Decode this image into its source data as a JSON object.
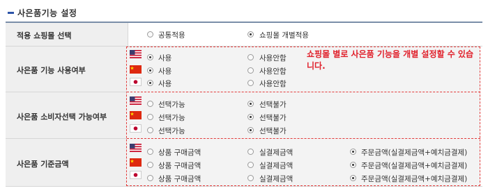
{
  "page_title": "사은품기능 설정",
  "colors": {
    "accent": "#2d54a8",
    "note": "#e0202b",
    "dash_border": "#e23a3a"
  },
  "rows": {
    "mall_select": {
      "label": "적용 쇼핑몰 선택",
      "options": [
        {
          "label": "공통적용",
          "selected": false
        },
        {
          "label": "쇼핑몰 개별적용",
          "selected": true
        }
      ]
    },
    "use": {
      "label": "사은품 기능 사용여부",
      "flags": [
        "us-flag-icon",
        "cn-flag-icon",
        "jp-flag-icon"
      ],
      "lines": [
        {
          "options": [
            {
              "label": "사용",
              "selected": true
            },
            {
              "label": "사용안함",
              "selected": false
            }
          ]
        },
        {
          "options": [
            {
              "label": "사용",
              "selected": true
            },
            {
              "label": "사용안함",
              "selected": false
            }
          ]
        },
        {
          "options": [
            {
              "label": "사용",
              "selected": true
            },
            {
              "label": "사용안함",
              "selected": false
            }
          ]
        }
      ]
    },
    "consumer_choice": {
      "label": "사은품 소비자선택 가능여부",
      "lines": [
        {
          "options": [
            {
              "label": "선택가능",
              "selected": false
            },
            {
              "label": "선택불가",
              "selected": true
            }
          ]
        },
        {
          "options": [
            {
              "label": "선택가능",
              "selected": false
            },
            {
              "label": "선택불가",
              "selected": true
            }
          ]
        },
        {
          "options": [
            {
              "label": "선택가능",
              "selected": false
            },
            {
              "label": "선택불가",
              "selected": true
            }
          ]
        }
      ]
    },
    "base_amount": {
      "label": "사은품 기준금액",
      "lines": [
        {
          "options": [
            {
              "label": "상품 구매금액",
              "selected": false
            },
            {
              "label": "실결제금액",
              "selected": false
            },
            {
              "label": "주문금액(실결제금액+예치금결제)",
              "selected": true
            }
          ]
        },
        {
          "options": [
            {
              "label": "상품 구매금액",
              "selected": false
            },
            {
              "label": "실결제금액",
              "selected": false
            },
            {
              "label": "주문금액(실결제금액+예치금결제)",
              "selected": true
            }
          ]
        },
        {
          "options": [
            {
              "label": "상품 구매금액",
              "selected": false
            },
            {
              "label": "실결제금액",
              "selected": false
            },
            {
              "label": "주문금액(실결제금액+예치금결제)",
              "selected": true
            }
          ]
        }
      ]
    }
  },
  "note": "쇼핑몰 별로 사은품 기능을 개별 설정할 수 있습니다."
}
